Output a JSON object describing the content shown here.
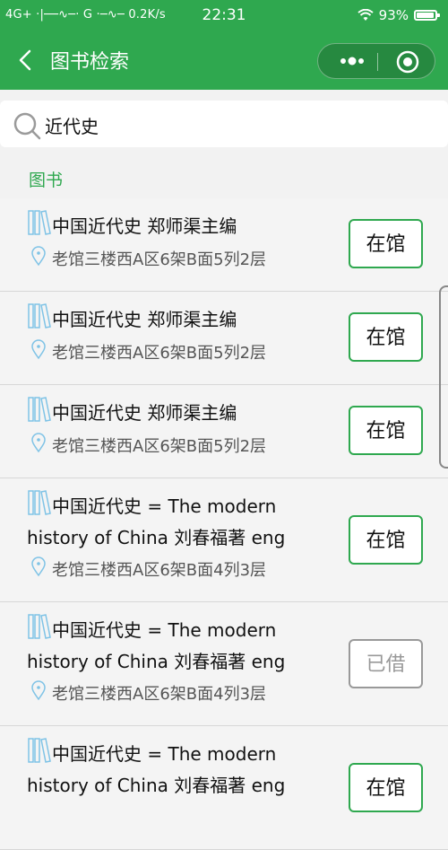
{
  "status_bar": {
    "left_text": "4G+ ·|──∿─· G ·─∿─ 0.2K/s",
    "time": "22:31",
    "battery": "93%",
    "battery_level": 0.93
  },
  "nav": {
    "title": "图书检索",
    "back_icon": "chevron-left-icon",
    "more_icon": "more-dots-icon",
    "close_icon": "target-circle-icon"
  },
  "search": {
    "value": "近代史",
    "icon": "search-icon"
  },
  "section": {
    "label": "图书"
  },
  "colors": {
    "accent": "#2fa84f",
    "unavailable": "#999999"
  },
  "items": [
    {
      "title_line1": "中国近代史 郑师渠主编",
      "title_line2": "",
      "location": "老馆三楼西A区6架B面5列2层",
      "status": "在馆",
      "available": true
    },
    {
      "title_line1": "中国近代史 郑师渠主编",
      "title_line2": "",
      "location": "老馆三楼西A区6架B面5列2层",
      "status": "在馆",
      "available": true
    },
    {
      "title_line1": "中国近代史 郑师渠主编",
      "title_line2": "",
      "location": "老馆三楼西A区6架B面5列2层",
      "status": "在馆",
      "available": true
    },
    {
      "title_line1": "中国近代史 = The modern",
      "title_line2": "history of China 刘春福著 eng",
      "location": "老馆三楼西A区6架B面4列3层",
      "status": "在馆",
      "available": true
    },
    {
      "title_line1": "中国近代史 = The modern",
      "title_line2": "history of China 刘春福著 eng",
      "location": "老馆三楼西A区6架B面4列3层",
      "status": "已借",
      "available": false
    },
    {
      "title_line1": "中国近代史 = The modern",
      "title_line2": "history of China 刘春福著 eng",
      "location": "",
      "status": "在馆",
      "available": true
    }
  ]
}
